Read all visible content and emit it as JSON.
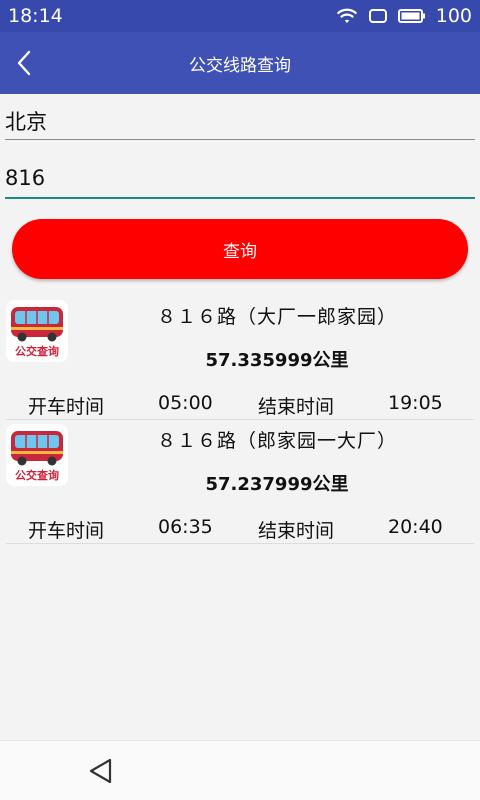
{
  "status_bar": {
    "time": "18:14",
    "battery": "100"
  },
  "app_bar": {
    "title": "公交线路查询",
    "back_icon": "chevron-left-icon"
  },
  "form": {
    "city": "北京",
    "route": "816",
    "query_label": "查询"
  },
  "results": [
    {
      "icon_caption": "公交查询",
      "route_name": "８１６路（大厂一郎家园）",
      "distance": "57.335999公里",
      "start_label": "开车时间",
      "start_time": "05:00",
      "end_label": "结束时间",
      "end_time": "19:05"
    },
    {
      "icon_caption": "公交查询",
      "route_name": "８１６路（郎家园一大厂）",
      "distance": "57.237999公里",
      "start_label": "开车时间",
      "start_time": "06:35",
      "end_label": "结束时间",
      "end_time": "20:40"
    }
  ],
  "colors": {
    "status_bar": "#3849ae",
    "app_bar": "#3f51b5",
    "query_button": "#ff0000",
    "input_focus": "#1e8a7e"
  },
  "nav_bar": {
    "back_icon": "triangle-back-icon"
  }
}
